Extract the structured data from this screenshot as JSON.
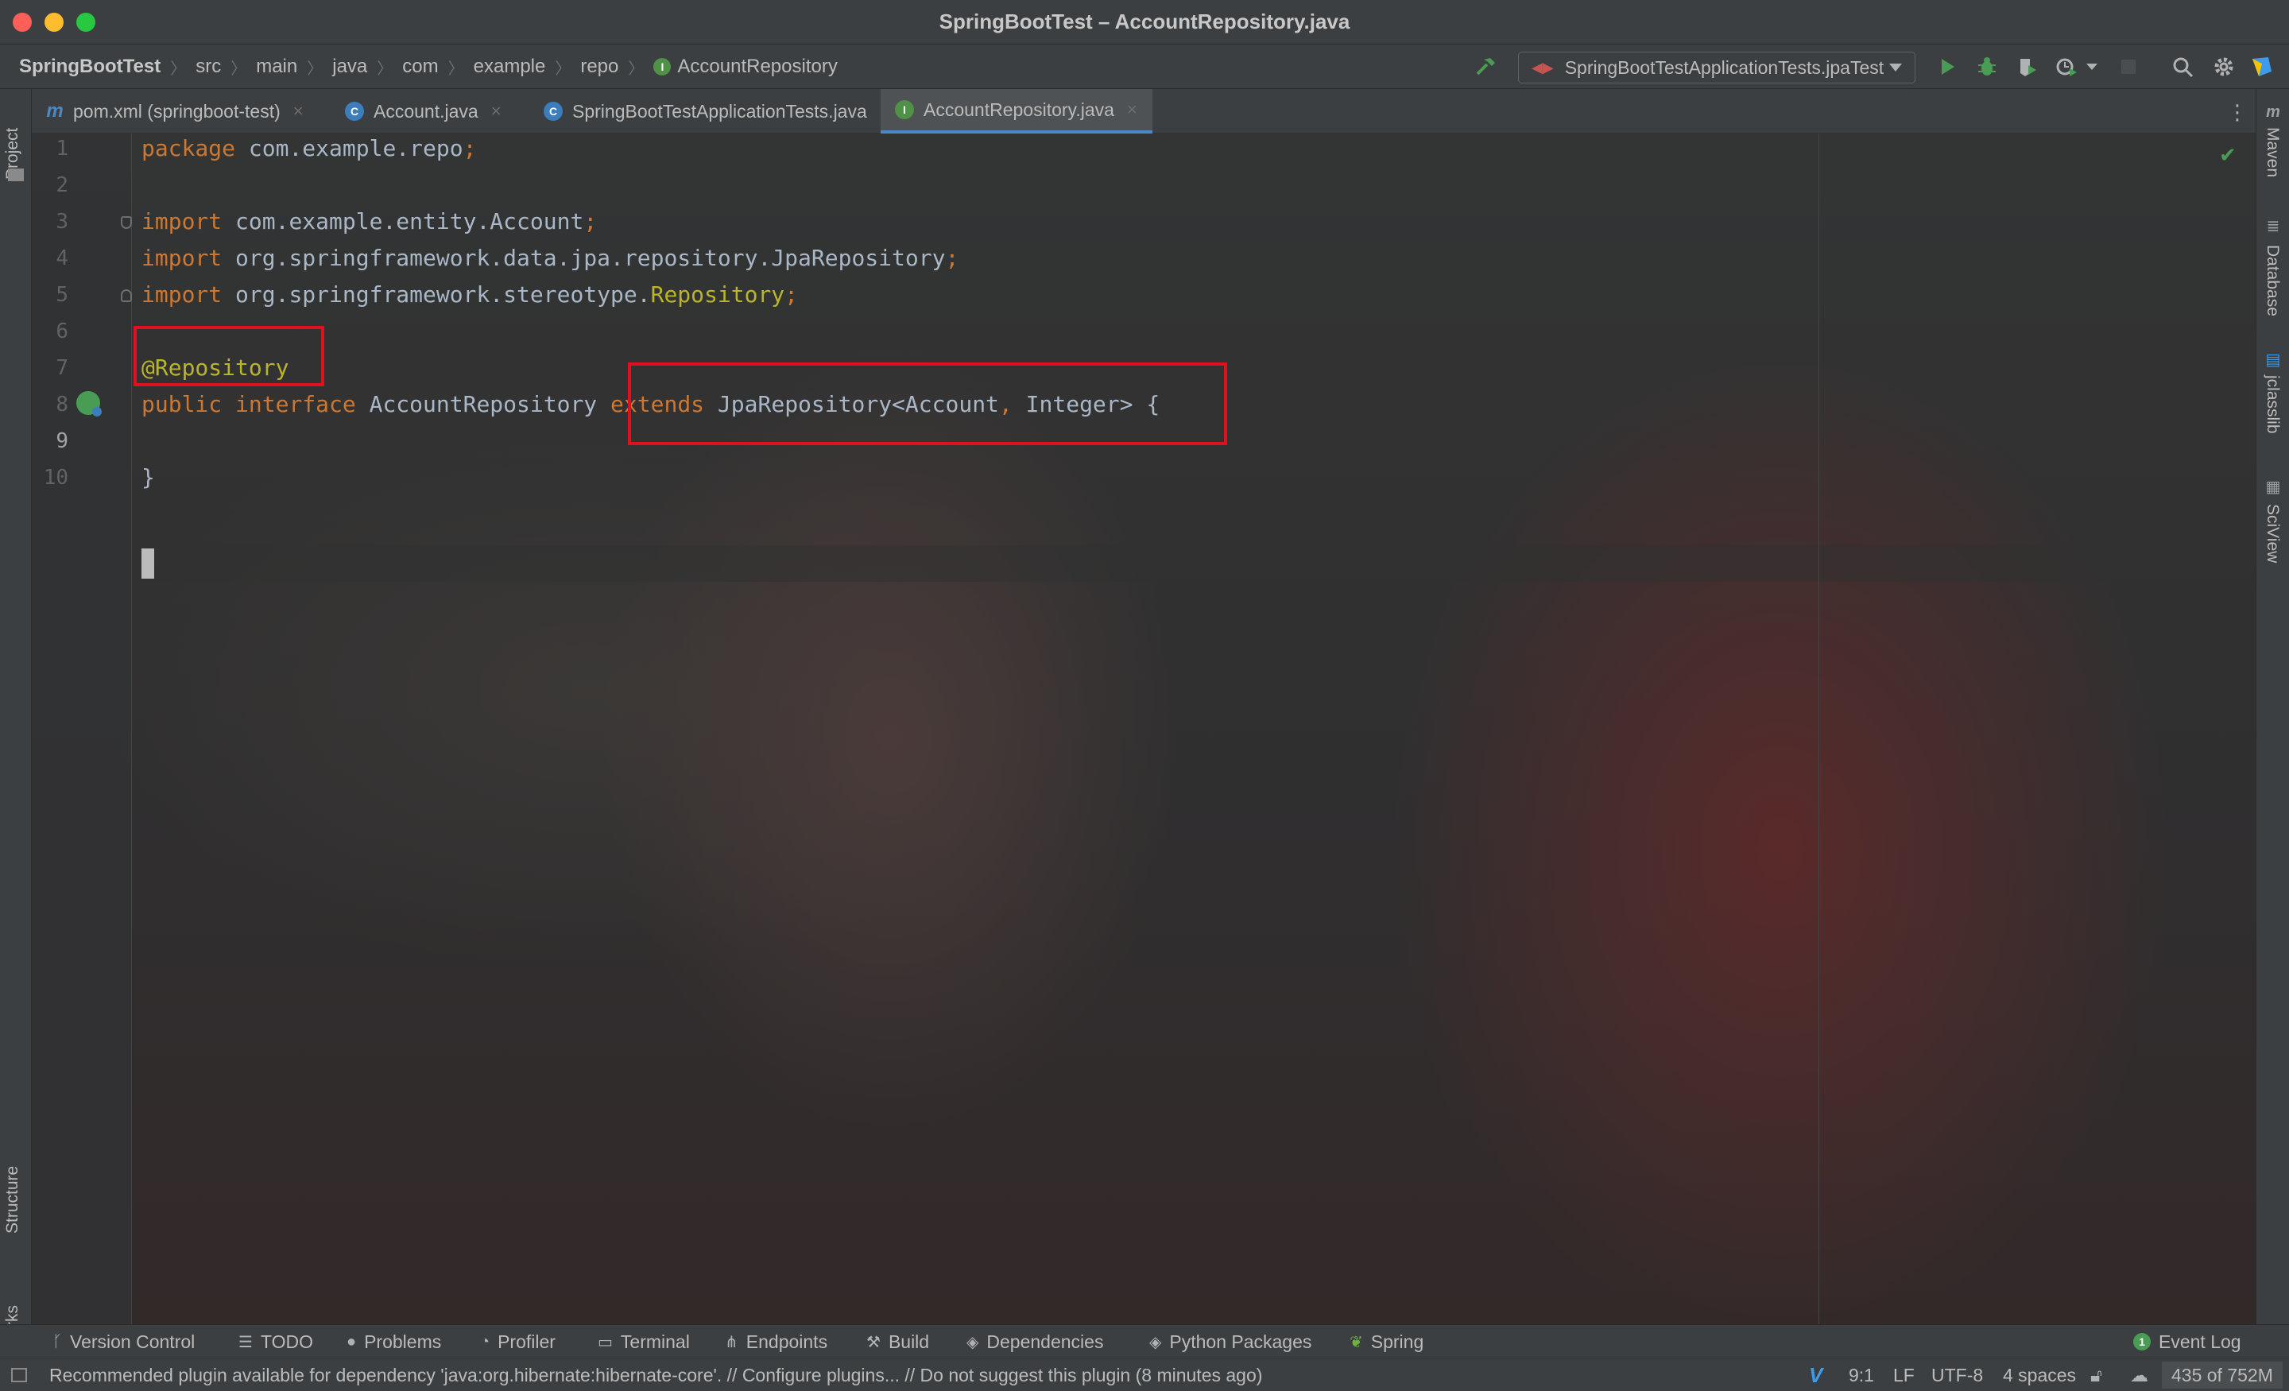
{
  "window": {
    "title": "SpringBootTest – AccountRepository.java"
  },
  "breadcrumb": {
    "project": "SpringBootTest",
    "items": [
      "src",
      "main",
      "java",
      "com",
      "example",
      "repo"
    ],
    "current": "AccountRepository"
  },
  "run_config": {
    "label": "SpringBootTestApplicationTests.jpaTest"
  },
  "left_strip": {
    "project": "Project",
    "structure": "Structure",
    "bookmarks": "Bookmarks"
  },
  "right_strip": {
    "maven": "Maven",
    "database": "Database",
    "jclasslib": "jclasslib",
    "sciview": "SciView"
  },
  "tabs": [
    {
      "label": "pom.xml (springboot-test)",
      "icon": "maven-icon",
      "active": false
    },
    {
      "label": "Account.java",
      "icon": "class-icon",
      "active": false
    },
    {
      "label": "SpringBootTestApplicationTests.java",
      "icon": "class-icon",
      "active": false
    },
    {
      "label": "AccountRepository.java",
      "icon": "interface-icon",
      "active": true
    }
  ],
  "editor": {
    "line_numbers": [
      "1",
      "2",
      "3",
      "4",
      "5",
      "6",
      "7",
      "8",
      "9",
      "10"
    ],
    "current_line": 9,
    "lines": {
      "l1": {
        "kw": "package",
        "rest": " com.example.repo",
        "semi": ";"
      },
      "l3": {
        "kw": "import",
        "rest": " com.example.entity.Account",
        "semi": ";"
      },
      "l4": {
        "kw": "import",
        "rest": " org.springframework.data.jpa.repository.JpaRepository",
        "semi": ";"
      },
      "l5": {
        "kw": "import",
        "rest": " org.springframework.stereotype.",
        "cls": "Repository",
        "semi": ";"
      },
      "l7": {
        "annotation": "@Repository"
      },
      "l8": {
        "kw1": "public",
        "kw2": "interface",
        "name": " AccountRepository ",
        "kw3": "extends",
        "generic_a": " JpaRepository<Account",
        "comma": ",",
        "generic_b": " Integer> ",
        "brace": "{"
      },
      "l10": {
        "brace": "}"
      }
    },
    "highlight_color": "#e0101e"
  },
  "tool_windows": [
    {
      "label": "Version Control",
      "icon": "branch-icon"
    },
    {
      "label": "TODO",
      "icon": "list-icon"
    },
    {
      "label": "Problems",
      "icon": "info-icon"
    },
    {
      "label": "Profiler",
      "icon": "profiler-icon"
    },
    {
      "label": "Terminal",
      "icon": "terminal-icon"
    },
    {
      "label": "Endpoints",
      "icon": "endpoints-icon"
    },
    {
      "label": "Build",
      "icon": "hammer-icon"
    },
    {
      "label": "Dependencies",
      "icon": "layers-icon"
    },
    {
      "label": "Python Packages",
      "icon": "layers-icon"
    },
    {
      "label": "Spring",
      "icon": "leaf-icon"
    }
  ],
  "event_log": {
    "label": "Event Log",
    "count": "1"
  },
  "status": {
    "message": "Recommended plugin available for dependency 'java:org.hibernate:hibernate-core'. // Configure plugins... // Do not suggest this plugin (8 minutes ago)",
    "vim": "V",
    "position": "9:1",
    "line_sep": "LF",
    "encoding": "UTF-8",
    "indent": "4 spaces",
    "memory": "435 of 752M"
  },
  "colors": {
    "keyword": "#cc7832",
    "annotation": "#bbb529",
    "plain": "#a9b7c6",
    "accent": "#4a88c7",
    "run": "#499c54"
  }
}
